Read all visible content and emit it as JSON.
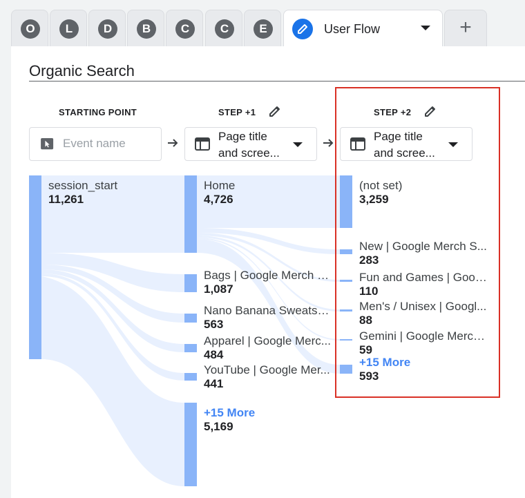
{
  "tabs": [
    {
      "letter": "O"
    },
    {
      "letter": "L"
    },
    {
      "letter": "D"
    },
    {
      "letter": "B"
    },
    {
      "letter": "C"
    },
    {
      "letter": "C"
    },
    {
      "letter": "E"
    }
  ],
  "active_tab": {
    "label": "User Flow"
  },
  "segment": {
    "title": "Organic Search"
  },
  "columns": {
    "start": {
      "header": "STARTING POINT",
      "placeholder": "Event name"
    },
    "step1": {
      "header": "STEP +1",
      "select_line1": "Page title",
      "select_line2": "and scree..."
    },
    "step2": {
      "header": "STEP +2",
      "select_line1": "Page title",
      "select_line2": "and scree..."
    }
  },
  "start_node": {
    "name": "session_start",
    "value": "11,261"
  },
  "step1_nodes": [
    {
      "name": "Home",
      "value": "4,726"
    },
    {
      "name": "Bags | Google Merch S...",
      "value": "1,087"
    },
    {
      "name": "Nano Banana Sweatsh...",
      "value": "563"
    },
    {
      "name": "Apparel | Google Merc...",
      "value": "484"
    },
    {
      "name": "YouTube | Google Mer...",
      "value": "441"
    }
  ],
  "step1_more": {
    "label": "+15 More",
    "value": "5,169"
  },
  "step2_nodes": [
    {
      "name": "(not set)",
      "value": "3,259"
    },
    {
      "name": "New | Google Merch S...",
      "value": "283"
    },
    {
      "name": "Fun and Games | Goog...",
      "value": "110"
    },
    {
      "name": "Men's / Unisex | Googl...",
      "value": "88"
    },
    {
      "name": "Gemini | Google Merch ...",
      "value": "59"
    }
  ],
  "step2_more": {
    "label": "+15 More",
    "value": "593"
  },
  "colors": {
    "node": "#8ab4f8",
    "flow": "#e8f0fe",
    "highlight": "#d93025",
    "accent": "#1a73e8"
  }
}
